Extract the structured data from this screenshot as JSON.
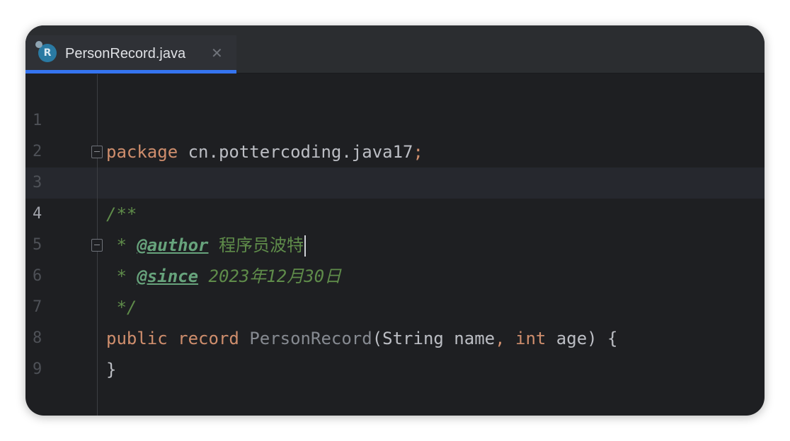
{
  "tab": {
    "icon_letter": "R",
    "title": "PersonRecord.java",
    "close_glyph": "✕"
  },
  "editor": {
    "line_numbers": [
      "1",
      "2",
      "3",
      "4",
      "5",
      "6",
      "7",
      "8",
      "9"
    ],
    "current_line": 4,
    "code": {
      "l1_kw": "package",
      "l1_rest": " cn.pottercoding.java17",
      "l1_semi": ";",
      "l3_comment": "/**",
      "l4_star": " * ",
      "l4_tag": "@author",
      "l4_space": " ",
      "l4_text": "程序员波特",
      "l5_star": " * ",
      "l5_tag": "@since",
      "l5_text": " 2023年12月30日",
      "l6_comment": " */",
      "l7_kw1": "public",
      "l7_kw2": "record",
      "l7_cls": "PersonRecord",
      "l7_p1": "(String name",
      "l7_comma": ",",
      "l7_kw3": "int",
      "l7_p2": " age) {",
      "l8_brace": "}"
    }
  }
}
